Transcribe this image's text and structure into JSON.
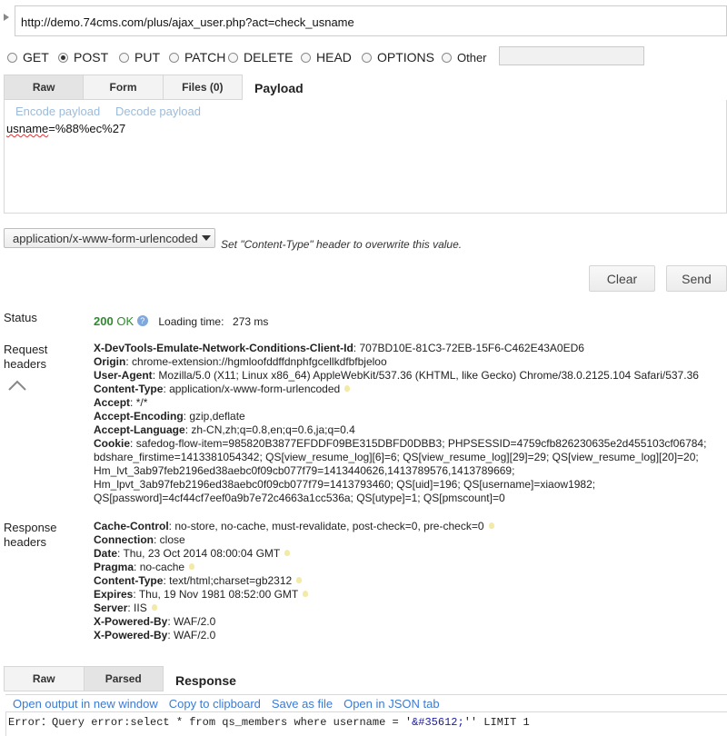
{
  "url": "http://demo.74cms.com/plus/ajax_user.php?act=check_usname",
  "methods": [
    {
      "label": "GET",
      "checked": false
    },
    {
      "label": "POST",
      "checked": true
    },
    {
      "label": "PUT",
      "checked": false
    },
    {
      "label": "PATCH",
      "checked": false
    },
    {
      "label": "DELETE",
      "checked": false
    },
    {
      "label": "HEAD",
      "checked": false
    },
    {
      "label": "OPTIONS",
      "checked": false
    },
    {
      "label": "Other",
      "checked": false
    }
  ],
  "request_tabs": [
    "Raw",
    "Form",
    "Files (0)"
  ],
  "request_tab_title": "Payload",
  "payload_links": [
    "Encode payload",
    "Decode payload"
  ],
  "payload": {
    "name": "usname",
    "rest": "=%88%ec%27"
  },
  "content_type": "application/x-www-form-urlencoded",
  "content_type_hint": "Set \"Content-Type\" header to overwrite this value.",
  "buttons": {
    "clear": "Clear",
    "send": "Send"
  },
  "status": {
    "label": "Status",
    "code": "200",
    "text": "OK",
    "loading_label": "Loading time:",
    "loading_value": "273 ms"
  },
  "request_headers_label": [
    "Request",
    "headers"
  ],
  "request_headers": [
    {
      "name": "X-DevTools-Emulate-Network-Conditions-Client-Id",
      "value": "707BD10E-81C3-72EB-15F6-C462E43A0ED6",
      "bulb": false
    },
    {
      "name": "Origin",
      "value": "chrome-extension://hgmloofddffdnphfgcellkdfbfbjeloo",
      "bulb": false
    },
    {
      "name": "User-Agent",
      "value": "Mozilla/5.0 (X11; Linux x86_64) AppleWebKit/537.36 (KHTML, like Gecko) Chrome/38.0.2125.104 Safari/537.36",
      "bulb": false
    },
    {
      "name": "Content-Type",
      "value": "application/x-www-form-urlencoded",
      "bulb": true
    },
    {
      "name": "Accept",
      "value": "*/*",
      "bulb": false
    },
    {
      "name": "Accept-Encoding",
      "value": "gzip,deflate",
      "bulb": false
    },
    {
      "name": "Accept-Language",
      "value": "zh-CN,zh;q=0.8,en;q=0.6,ja;q=0.4",
      "bulb": false
    },
    {
      "name": "Cookie",
      "value": "safedog-flow-item=985820B3877EFDDF09BE315DBFD0DBB3; PHPSESSID=4759cfb826230635e2d455103cf06784;",
      "bulb": false
    }
  ],
  "cookie_continuation": [
    "bdshare_firstime=1413381054342; QS[view_resume_log][6]=6; QS[view_resume_log][29]=29; QS[view_resume_log][20]=20;",
    "Hm_lvt_3ab97feb2196ed38aebc0f09cb077f79=1413440626,1413789576,1413789669;",
    "Hm_lpvt_3ab97feb2196ed38aebc0f09cb077f79=1413793460; QS[uid]=196; QS[username]=xiaow1982;",
    "QS[password]=4cf44cf7eef0a9b7e72c4663a1cc536a; QS[utype]=1; QS[pmscount]=0"
  ],
  "response_headers_label": [
    "Response",
    "headers"
  ],
  "response_headers": [
    {
      "name": "Cache-Control",
      "value": "no-store, no-cache, must-revalidate, post-check=0, pre-check=0",
      "bulb": true
    },
    {
      "name": "Connection",
      "value": "close",
      "bulb": false
    },
    {
      "name": "Date",
      "value": "Thu, 23 Oct 2014 08:00:04 GMT",
      "bulb": true
    },
    {
      "name": "Pragma",
      "value": "no-cache",
      "bulb": true
    },
    {
      "name": "Content-Type",
      "value": "text/html;charset=gb2312",
      "bulb": true
    },
    {
      "name": "Expires",
      "value": "Thu, 19 Nov 1981 08:52:00 GMT",
      "bulb": true
    },
    {
      "name": "Server",
      "value": "IIS",
      "bulb": true
    },
    {
      "name": "X-Powered-By",
      "value": "WAF/2.0",
      "bulb": false
    },
    {
      "name": "X-Powered-By",
      "value": "WAF/2.0",
      "bulb": false
    }
  ],
  "response_tabs": [
    "Raw",
    "Parsed"
  ],
  "response_tab_title": "Response",
  "response_links": [
    "Open output in new window",
    "Copy to clipboard",
    "Save as file",
    "Open in JSON tab"
  ],
  "response_body": {
    "before": "Error：Query error:select * from qs_members where username = '",
    "highlight": "&#35612;",
    "after": "'' LIMIT 1"
  },
  "colors": {
    "status_ok": "#2e8b2e",
    "link": "#3a7bd5",
    "link_light": "#9dbbd9"
  }
}
